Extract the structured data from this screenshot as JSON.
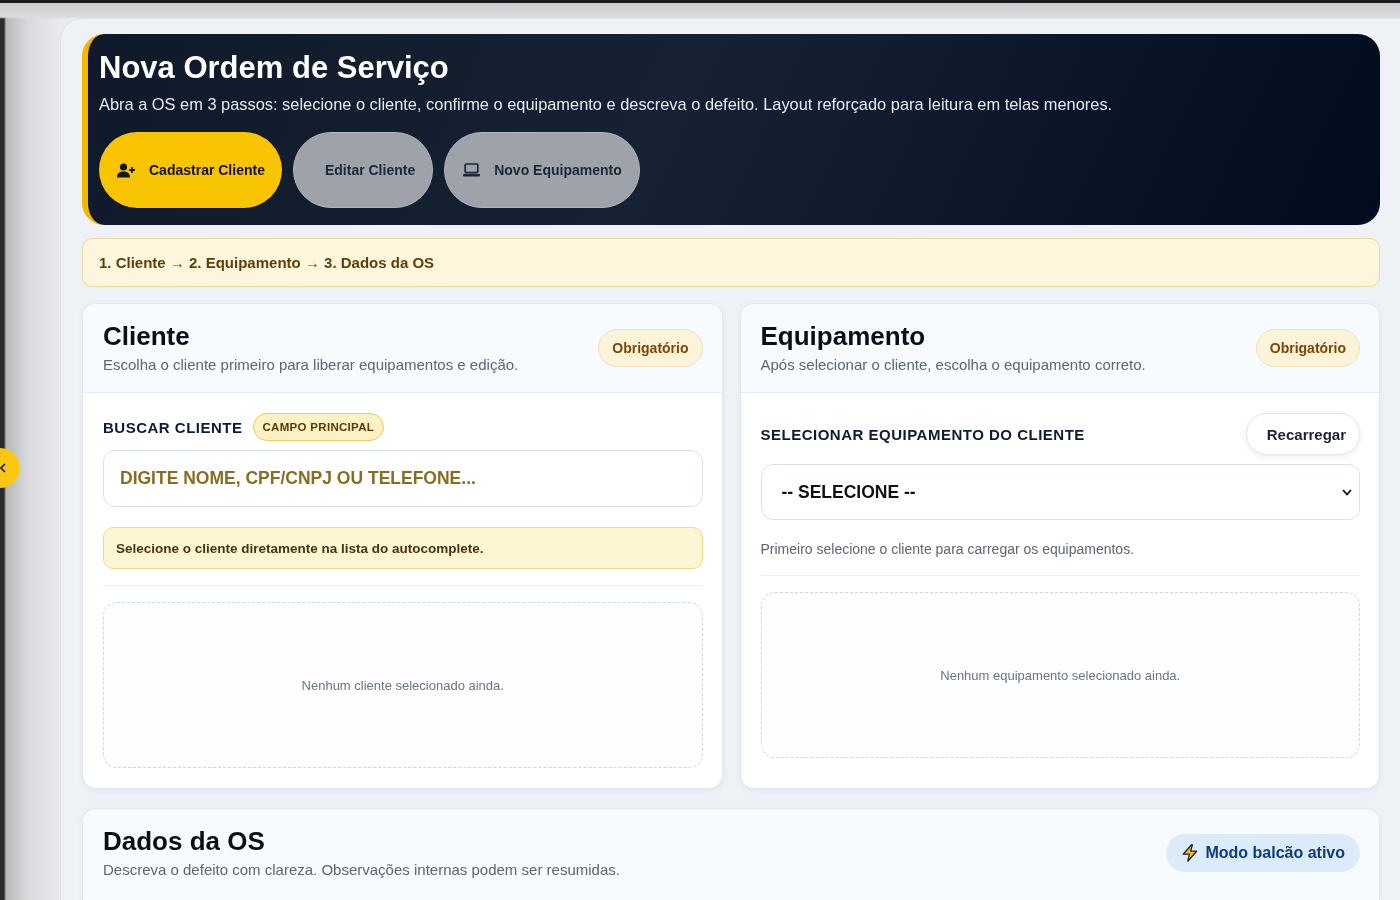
{
  "header": {
    "title": "Nova Ordem de Serviço",
    "subtitle": "Abra a OS em 3 passos: selecione o cliente, confirme o equipamento e descreva o defeito. Layout reforçado para leitura em telas menores.",
    "actions": [
      {
        "label": "Cadastrar Cliente",
        "disabled": false
      },
      {
        "label": "Editar Cliente",
        "disabled": true
      },
      {
        "label": "Novo Equipamento",
        "disabled": true
      }
    ]
  },
  "steps": "1. Cliente → 2. Equipamento → 3. Dados da OS",
  "cliente": {
    "title": "Cliente",
    "subtitle": "Escolha o cliente primeiro para liberar equipamentos e edição.",
    "badge": "Obrigatório",
    "search": {
      "label": "BUSCAR CLIENTE",
      "tag": "CAMPO PRINCIPAL",
      "placeholder": "DIGITE NOME, CPF/CNPJ OU TELEFONE..."
    },
    "notice": "Selecione o cliente diretamente na lista do autocomplete.",
    "empty_state": "Nenhum cliente selecionado ainda."
  },
  "equipamento": {
    "title": "Equipamento",
    "subtitle": "Após selecionar o cliente, escolha o equipamento correto.",
    "badge": "Obrigatório",
    "select": {
      "label": "SELECIONAR EQUIPAMENTO DO CLIENTE",
      "value": "-- SELECIONE --"
    },
    "reload_button": "Recarregar",
    "help": "Primeiro selecione o cliente para carregar os equipamentos.",
    "empty_state": "Nenhum equipamento selecionado ainda."
  },
  "dados_os": {
    "title": "Dados da OS",
    "subtitle": "Descreva o defeito com clareza. Observações internas podem ser resumidas.",
    "mode_badge": "Modo balcão ativo"
  }
}
